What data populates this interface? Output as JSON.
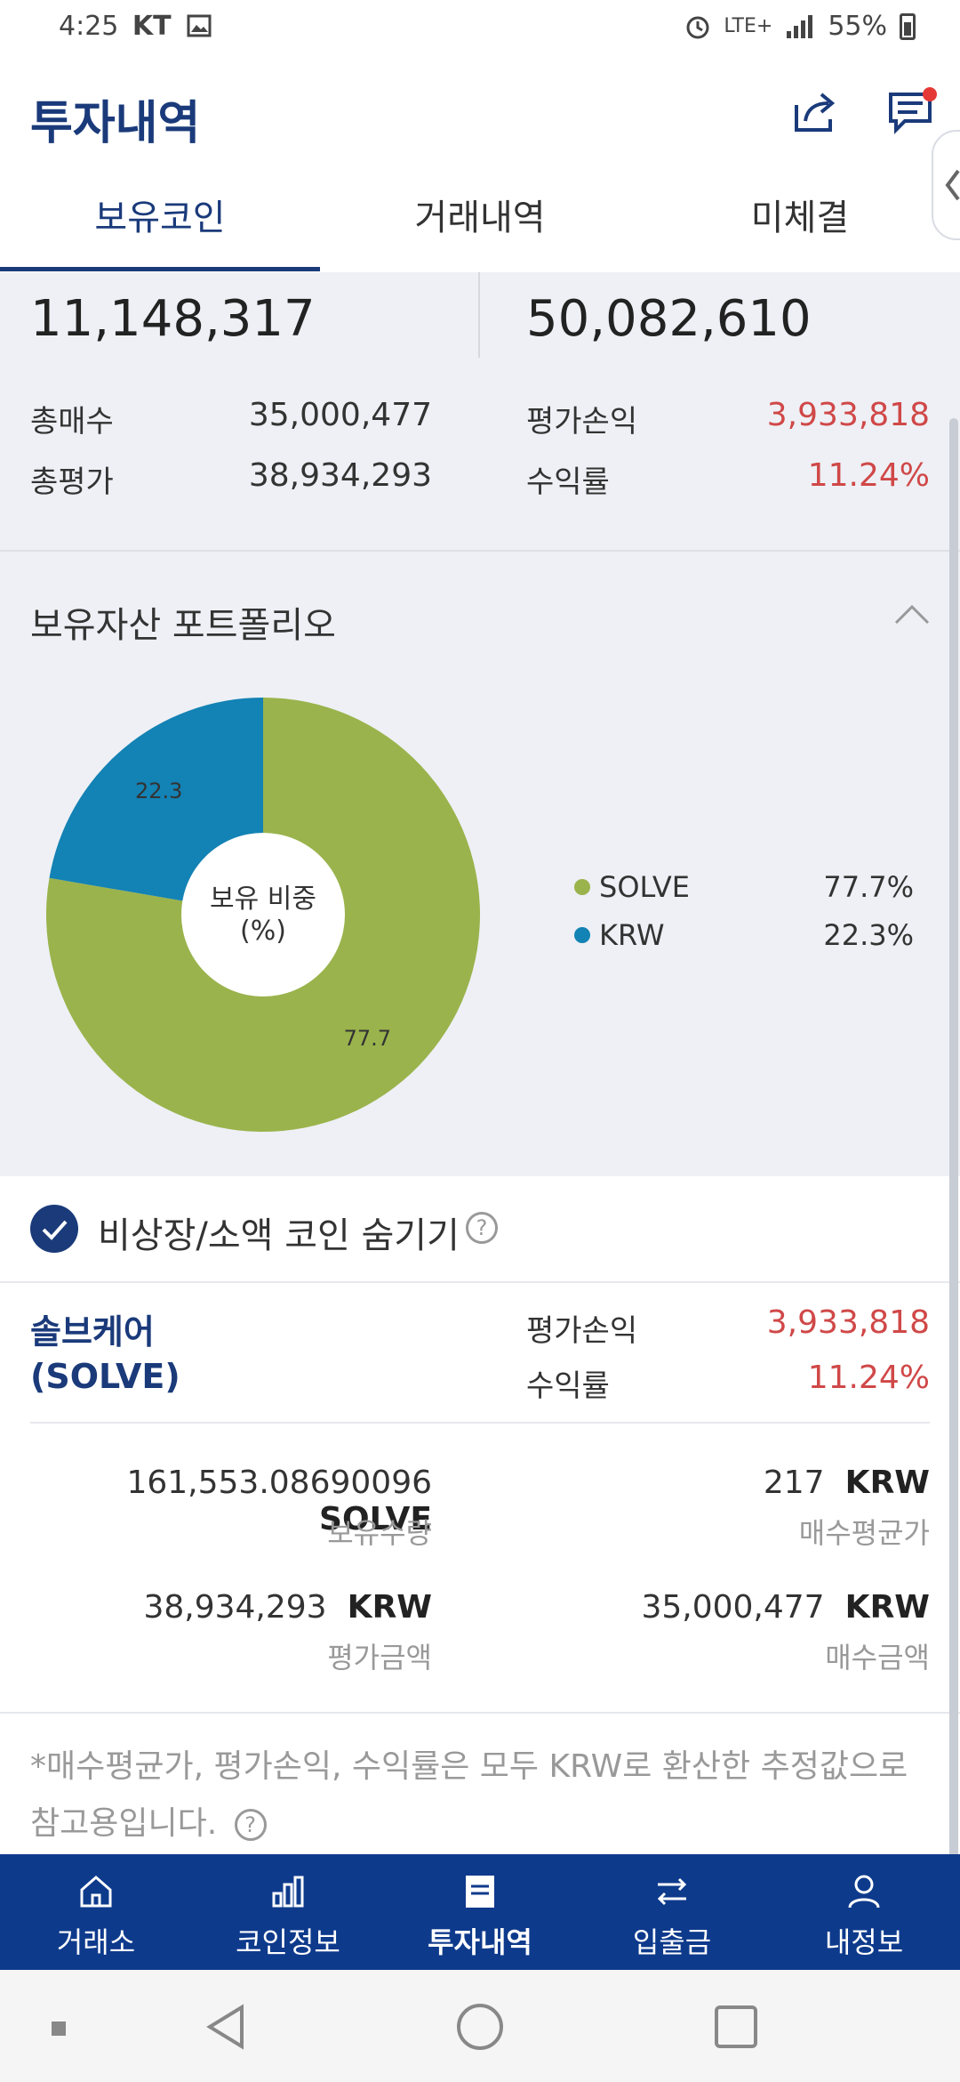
{
  "status_bar": {
    "time": "4:25",
    "carrier": "KT",
    "network": "LTE+",
    "battery": "55%"
  },
  "header": {
    "title": "투자내역"
  },
  "tabs": [
    {
      "label": "보유코인"
    },
    {
      "label": "거래내역"
    },
    {
      "label": "미체결"
    }
  ],
  "summary": {
    "left_big": "11,148,317",
    "right_big": "50,082,610",
    "rows": [
      {
        "label": "총매수",
        "value": "35,000,477"
      },
      {
        "label": "총평가",
        "value": "38,934,293"
      },
      {
        "label": "평가손익",
        "value": "3,933,818"
      },
      {
        "label": "수익률",
        "value": "11.24%"
      }
    ]
  },
  "portfolio": {
    "title": "보유자산 포트폴리오",
    "center_label_line1": "보유 비중",
    "center_label_line2": "(%)"
  },
  "chart_data": {
    "type": "pie",
    "title": "",
    "categories": [
      "SOLVE",
      "KRW"
    ],
    "values": [
      77.7,
      22.3
    ],
    "colors": [
      "#9ab34c",
      "#1382b4"
    ],
    "slice_labels": [
      "77.7",
      "22.3"
    ],
    "legend": [
      {
        "name": "SOLVE",
        "value": "77.7%"
      },
      {
        "name": "KRW",
        "value": "22.3%"
      }
    ],
    "legend_position": "right"
  },
  "hide_toggle": {
    "label": "비상장/소액 코인 숨기기",
    "checked": true,
    "help": "?"
  },
  "holding": {
    "name_line1": "솔브케어",
    "name_line2": "(SOLVE)",
    "pnl_label": "평가손익",
    "pnl_value": "3,933,818",
    "rate_label": "수익률",
    "rate_value": "11.24%",
    "quantity": "161,553.08690096",
    "quantity_unit": "SOLVE",
    "quantity_label": "보유수량",
    "avg_price": "217",
    "avg_price_unit": "KRW",
    "avg_price_label": "매수평균가",
    "eval_amount": "38,934,293",
    "eval_amount_unit": "KRW",
    "eval_amount_label": "평가금액",
    "buy_amount": "35,000,477",
    "buy_amount_unit": "KRW",
    "buy_amount_label": "매수금액"
  },
  "note": {
    "line1": "*매수평균가, 평가손익, 수익률은 모두 KRW로 환산한 추정값으로",
    "line2": "참고용입니다.",
    "help": "?"
  },
  "bottom_nav": [
    {
      "label": "거래소",
      "icon": "home-icon"
    },
    {
      "label": "코인정보",
      "icon": "bar-chart-icon"
    },
    {
      "label": "투자내역",
      "icon": "document-icon",
      "active": true
    },
    {
      "label": "입출금",
      "icon": "transfer-icon"
    },
    {
      "label": "내정보",
      "icon": "person-icon"
    }
  ]
}
